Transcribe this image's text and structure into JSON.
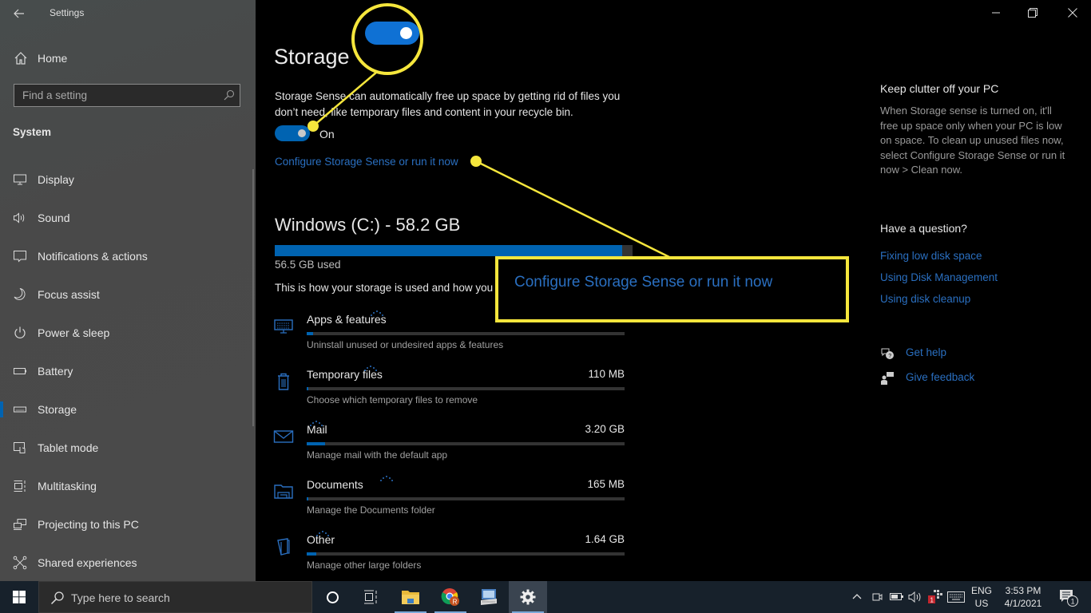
{
  "window": {
    "app_title": "Settings",
    "controls": {
      "minimize": "minimize",
      "restore": "restore",
      "close": "close"
    }
  },
  "sidebar": {
    "home_label": "Home",
    "search_placeholder": "Find a setting",
    "section_label": "System",
    "items": [
      {
        "label": "Display",
        "icon": "display-icon",
        "active": false
      },
      {
        "label": "Sound",
        "icon": "sound-icon",
        "active": false
      },
      {
        "label": "Notifications & actions",
        "icon": "notifications-icon",
        "active": false
      },
      {
        "label": "Focus assist",
        "icon": "moon-icon",
        "active": false
      },
      {
        "label": "Power & sleep",
        "icon": "power-icon",
        "active": false
      },
      {
        "label": "Battery",
        "icon": "battery-icon",
        "active": false
      },
      {
        "label": "Storage",
        "icon": "storage-icon",
        "active": true
      },
      {
        "label": "Tablet mode",
        "icon": "tablet-mode-icon",
        "active": false
      },
      {
        "label": "Multitasking",
        "icon": "multitasking-icon",
        "active": false
      },
      {
        "label": "Projecting to this PC",
        "icon": "projecting-icon",
        "active": false
      },
      {
        "label": "Shared experiences",
        "icon": "shared-experiences-icon",
        "active": false
      }
    ]
  },
  "main": {
    "title": "Storage",
    "description": "Storage Sense can automatically free up space by getting rid of files you don’t need, like temporary files and content in your recycle bin.",
    "storage_sense": {
      "state": "On",
      "enabled": true
    },
    "configure_link": "Configure Storage Sense or run it now",
    "drive": {
      "title": "Windows (C:) - 58.2 GB",
      "used_label": "56.5 GB used",
      "used_fraction": 0.971
    },
    "storage_note": "This is how your storage is used and how you can free up space.",
    "categories": [
      {
        "name": "Apps & features",
        "size": "",
        "desc": "Uninstall unused or undesired apps & features",
        "fraction": 0.02,
        "icon": "apps-features-icon"
      },
      {
        "name": "Temporary files",
        "size": "110 MB",
        "desc": "Choose which temporary files to remove",
        "fraction": 0.004,
        "icon": "trash-icon"
      },
      {
        "name": "Mail",
        "size": "3.20 GB",
        "desc": "Manage mail with the default app",
        "fraction": 0.057,
        "icon": "mail-icon"
      },
      {
        "name": "Documents",
        "size": "165 MB",
        "desc": "Manage the Documents folder",
        "fraction": 0.003,
        "icon": "documents-icon"
      },
      {
        "name": "Other",
        "size": "1.64 GB",
        "desc": "Manage other large folders",
        "fraction": 0.029,
        "icon": "other-folder-icon"
      }
    ]
  },
  "aside": {
    "clutter_heading": "Keep clutter off your PC",
    "clutter_body": "When Storage sense is turned on, it'll free up space only when your PC is low on space. To clean up unused files now, select Configure Storage Sense or run it now > Clean now.",
    "question_heading": "Have a question?",
    "links": [
      "Fixing low disk space",
      "Using Disk Management",
      "Using disk cleanup"
    ],
    "get_help": "Get help",
    "give_feedback": "Give feedback"
  },
  "annotations": {
    "callout_text": "Configure Storage Sense or run it now",
    "highlight_color": "#f5e63c"
  },
  "taskbar": {
    "search_placeholder": "Type here to search",
    "language_top": "ENG",
    "language_bottom": "US",
    "time": "3:53 PM",
    "date": "4/1/2021",
    "notification_count": "1",
    "tray_badge": "1"
  },
  "colors": {
    "accent": "#0063b1",
    "link": "#2a6fc0",
    "annotation": "#f5e63c"
  }
}
